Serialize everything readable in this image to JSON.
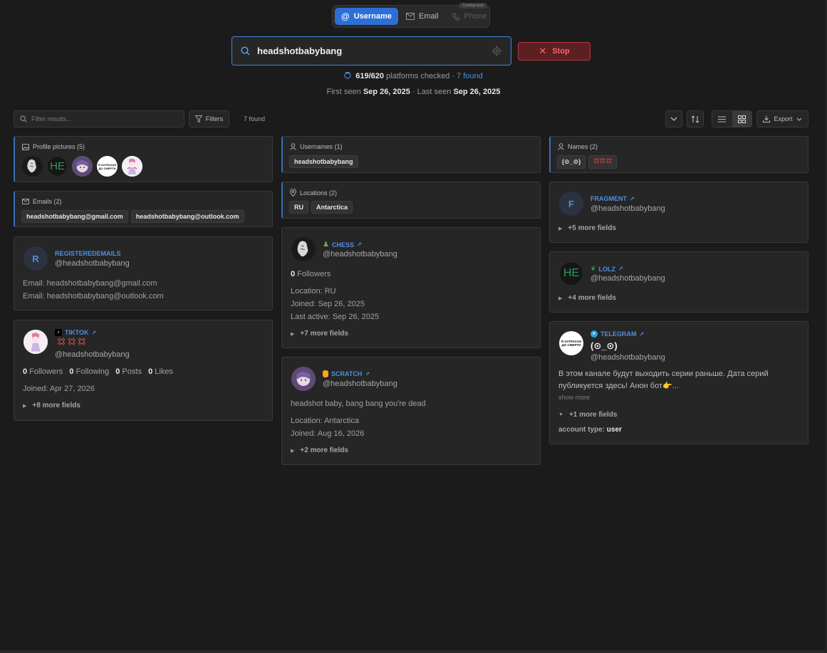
{
  "mode_tabs": {
    "username": "Username",
    "email": "Email",
    "phone": "Phone",
    "coming_soon": "Coming soon"
  },
  "search": {
    "value": "headshotbabybang",
    "stop_label": "Stop"
  },
  "progress": {
    "checked": "619/620",
    "checked_text": " platforms checked · ",
    "found": "7 found"
  },
  "seen": {
    "first_label": "First seen ",
    "first_date": "Sep 26, 2025",
    "sep": " · Last seen ",
    "last_date": "Sep 26, 2025"
  },
  "toolbar": {
    "filter_placeholder": "Filter results...",
    "filters_label": "Filters",
    "found_count": "7 found",
    "export_label": "Export"
  },
  "sections": {
    "profile_pictures": "Profile pictures (5)",
    "emails": "Emails (2)",
    "emails_list": [
      "headshotbabybang@gmail.com",
      "headshotbabybang@outlook.com"
    ],
    "usernames": "Usernames (1)",
    "usernames_list": [
      "headshotbabybang"
    ],
    "locations": "Locations (2)",
    "locations_list": [
      "RU",
      "Antarctica"
    ],
    "names": "Names (2)",
    "names_list": [
      "(⊙_⊙)",
      "💢💢💢"
    ]
  },
  "cards": {
    "registeredemails": {
      "initial": "R",
      "platform": "REGISTEREDEMAILS",
      "handle": "@headshotbabybang",
      "email1": "Email: headshotbabybang@gmail.com",
      "email2": "Email: headshotbabybang@outlook.com"
    },
    "tiktok": {
      "platform": "TIKTOK",
      "display_name": "💢💢💢",
      "handle": "@headshotbabybang",
      "followers": "0",
      "followers_label": " Followers",
      "following": "0",
      "following_label": " Following",
      "posts": "0",
      "posts_label": " Posts",
      "likes": "0",
      "likes_label": " Likes",
      "joined": "Joined: Apr 27, 2026",
      "more": "+8 more fields"
    },
    "chess": {
      "platform": "CHESS",
      "handle": "@headshotbabybang",
      "followers": "0",
      "followers_label": " Followers",
      "location": "Location: RU",
      "joined": "Joined: Sep 26, 2025",
      "last_active": "Last active: Sep 26, 2025",
      "more": "+7 more fields"
    },
    "scratch": {
      "platform": "SCRATCH",
      "handle": "@headshotbabybang",
      "bio": "headshot baby, bang bang you're dead",
      "location": "Location: Antarctica",
      "joined": "Joined: Aug 16, 2026",
      "more": "+2 more fields"
    },
    "fragment": {
      "initial": "F",
      "platform": "FRAGMENT",
      "handle": "@headshotbabybang",
      "more": "+5 more fields"
    },
    "lolz": {
      "initial": "HE",
      "platform": "LOLZ",
      "handle": "@headshotbabybang",
      "more": "+4 more fields"
    },
    "telegram": {
      "platform": "TELEGRAM",
      "display_name": "(⊙_⊙)",
      "handle": "@headshotbabybang",
      "bio_line1": "В этом канале будут выходить серии раньше. Дата серий",
      "bio_line2": "публикуется здесь! Анон бот👉...",
      "show_more": "show more",
      "more": "+1 more fields",
      "account_type_label": "account type: ",
      "account_type_value": "user",
      "avatar_text": "Я ЗАТРАХАН ДО СМЕРТИ"
    }
  },
  "colors": {
    "accent": "#2d6fd6",
    "link": "#4d8fe0",
    "stop": "#f06a6a",
    "background": "#1b1b1b",
    "card": "#262626"
  }
}
